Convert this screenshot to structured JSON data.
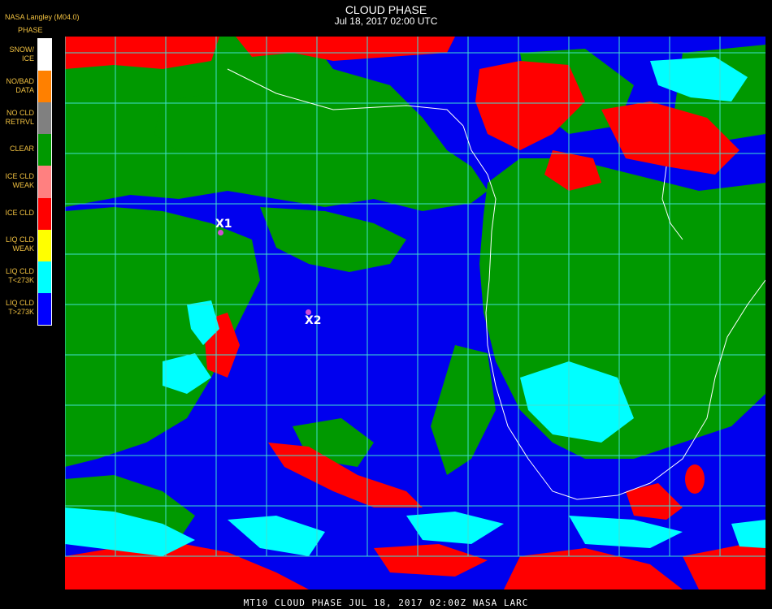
{
  "header": {
    "provider": "NASA Langley (M04.0)",
    "title": "CLOUD PHASE",
    "subtitle": "Jul 18, 2017 02:00 UTC"
  },
  "legend": {
    "title": "PHASE",
    "items": [
      {
        "label": "SNOW/\nICE",
        "color": "#ffffff"
      },
      {
        "label": "NO/BAD\nDATA",
        "color": "#ff8000"
      },
      {
        "label": "NO CLD\nRETRVL",
        "color": "#808080"
      },
      {
        "label": "CLEAR",
        "color": "#009900"
      },
      {
        "label": "ICE CLD\nWEAK",
        "color": "#ff8080"
      },
      {
        "label": "ICE CLD",
        "color": "#ff0000"
      },
      {
        "label": "LIQ CLD\nWEAK",
        "color": "#ffff00"
      },
      {
        "label": "LIQ CLD\nT<273K",
        "color": "#00ffff"
      },
      {
        "label": "LIQ CLD\nT>273K",
        "color": "#0000ff"
      }
    ]
  },
  "markers": [
    {
      "label": "X1"
    },
    {
      "label": "X2"
    }
  ],
  "footer": "MT10  CLOUD PHASE   JUL 18, 2017 02:00Z   NASA LARC",
  "colors": {
    "ocean_liquid": "#0000ee",
    "clear": "#009900",
    "ice": "#ff0000",
    "liquid_cold": "#00ffff",
    "grid": "#40e0d0",
    "coast": "#ffffff"
  }
}
